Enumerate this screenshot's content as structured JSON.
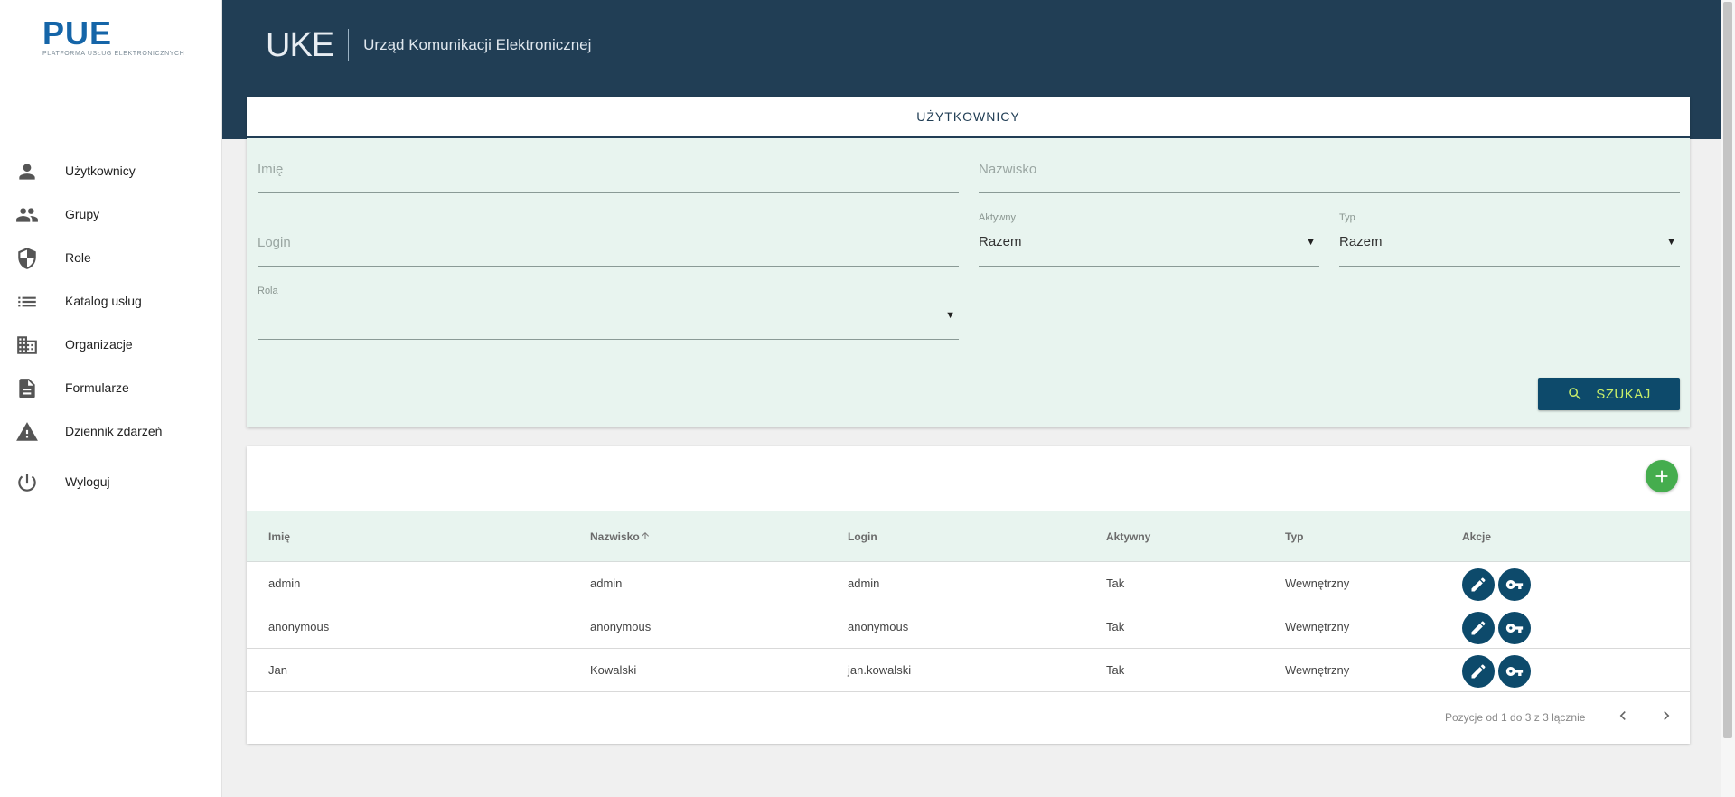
{
  "brand": {
    "logo": "PUE",
    "logo_sub": "PLATFORMA USŁUG ELEKTRONICZNYCH"
  },
  "header": {
    "logo_mark": "UKE",
    "title": "Urząd Komunikacji Elektronicznej"
  },
  "sidebar": {
    "items": [
      {
        "label": "Użytkownicy",
        "icon": "person-icon"
      },
      {
        "label": "Grupy",
        "icon": "group-icon"
      },
      {
        "label": "Role",
        "icon": "shield-icon"
      },
      {
        "label": "Katalog usług",
        "icon": "list-icon"
      },
      {
        "label": "Organizacje",
        "icon": "building-icon"
      },
      {
        "label": "Formularze",
        "icon": "document-icon"
      },
      {
        "label": "Dziennik zdarzeń",
        "icon": "warning-icon"
      },
      {
        "label": "Wyloguj",
        "icon": "power-icon"
      }
    ]
  },
  "search": {
    "tab": "UŻYTKOWNICY",
    "first_name_placeholder": "Imię",
    "last_name_placeholder": "Nazwisko",
    "login_placeholder": "Login",
    "active_label": "Aktywny",
    "active_value": "Razem",
    "type_label": "Typ",
    "type_value": "Razem",
    "role_label": "Rola",
    "role_value": "",
    "button": "SZUKAJ"
  },
  "table": {
    "columns": [
      "Imię",
      "Nazwisko",
      "Login",
      "Aktywny",
      "Typ",
      "Akcje"
    ],
    "rows": [
      {
        "first": "admin",
        "last": "admin",
        "login": "admin",
        "active": "Tak",
        "type": "Wewnętrzny"
      },
      {
        "first": "anonymous",
        "last": "anonymous",
        "login": "anonymous",
        "active": "Tak",
        "type": "Wewnętrzny"
      },
      {
        "first": "Jan",
        "last": "Kowalski",
        "login": "jan.kowalski",
        "active": "Tak",
        "type": "Wewnętrzny"
      }
    ],
    "pagination": "Pozycje od 1 do 3 z 3 łącznie"
  },
  "colors": {
    "header": "#213e55",
    "accent": "#0d4a6b",
    "add": "#45ad4e",
    "panel": "#e8f4ef",
    "button_text": "#c9ef6a"
  }
}
